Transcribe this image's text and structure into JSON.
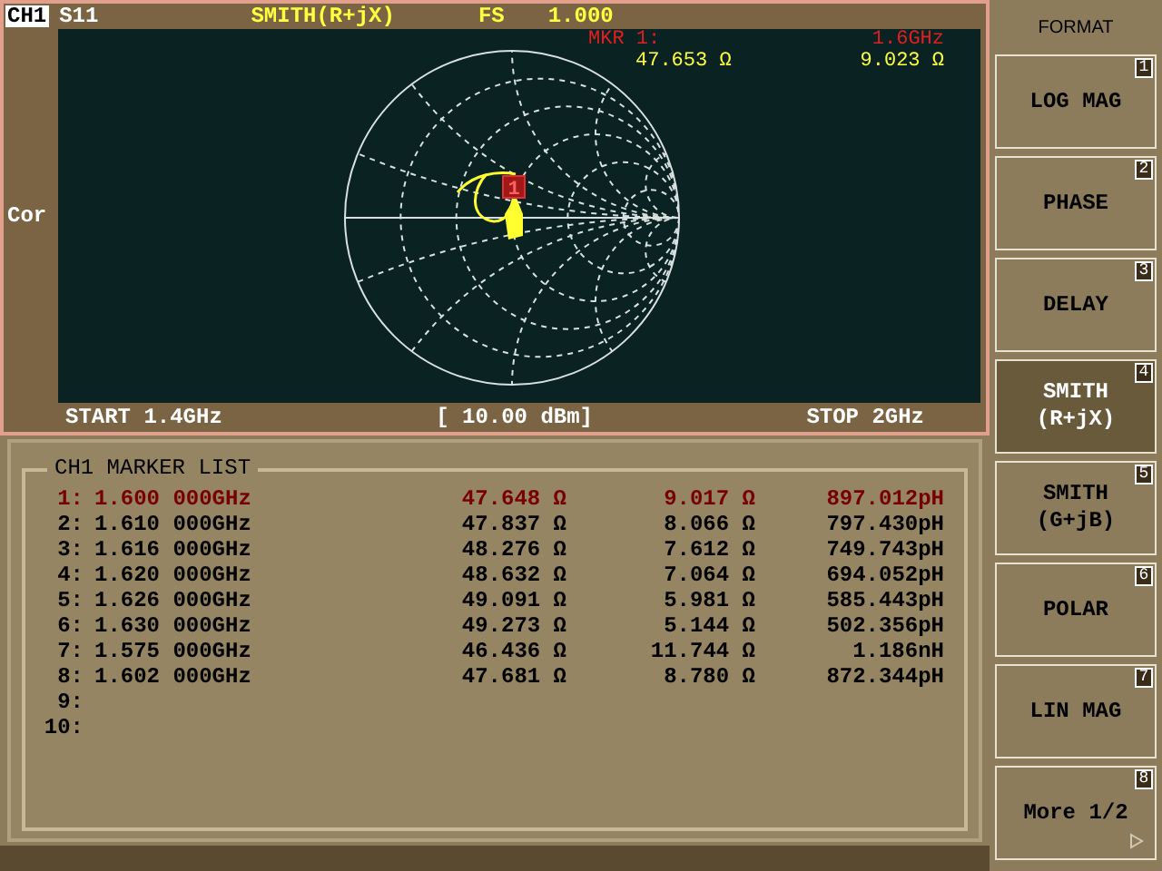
{
  "header": {
    "channel": "CH1",
    "parameter": "S11",
    "format": "SMITH(R+jX)",
    "scale_label": "FS",
    "scale_value": "1.000"
  },
  "side_label": "Cor",
  "marker_readout": {
    "label": "MKR  1:",
    "frequency": "1.6GHz",
    "resistance": "47.653 Ω",
    "reactance": "9.023 Ω"
  },
  "trace_marker": {
    "label": "1"
  },
  "footer": {
    "start": "START 1.4GHz",
    "power": "[ 10.00 dBm]",
    "stop": "STOP 2GHz"
  },
  "marker_list": {
    "title": "CH1 MARKER LIST",
    "rows": [
      {
        "number": "1:",
        "frequency": "1.600 000GHz",
        "resistance": "47.648 Ω",
        "reactance": "9.017 Ω",
        "equivalent": "897.012pH",
        "active": true
      },
      {
        "number": "2:",
        "frequency": "1.610 000GHz",
        "resistance": "47.837 Ω",
        "reactance": "8.066 Ω",
        "equivalent": "797.430pH",
        "active": false
      },
      {
        "number": "3:",
        "frequency": "1.616 000GHz",
        "resistance": "48.276 Ω",
        "reactance": "7.612 Ω",
        "equivalent": "749.743pH",
        "active": false
      },
      {
        "number": "4:",
        "frequency": "1.620 000GHz",
        "resistance": "48.632 Ω",
        "reactance": "7.064 Ω",
        "equivalent": "694.052pH",
        "active": false
      },
      {
        "number": "5:",
        "frequency": "1.626 000GHz",
        "resistance": "49.091 Ω",
        "reactance": "5.981 Ω",
        "equivalent": "585.443pH",
        "active": false
      },
      {
        "number": "6:",
        "frequency": "1.630 000GHz",
        "resistance": "49.273 Ω",
        "reactance": "5.144 Ω",
        "equivalent": "502.356pH",
        "active": false
      },
      {
        "number": "7:",
        "frequency": "1.575 000GHz",
        "resistance": "46.436 Ω",
        "reactance": "11.744 Ω",
        "equivalent": "1.186nH",
        "active": false
      },
      {
        "number": "8:",
        "frequency": "1.602 000GHz",
        "resistance": "47.681 Ω",
        "reactance": "8.780 Ω",
        "equivalent": "872.344pH",
        "active": false
      },
      {
        "number": "9:",
        "active": false
      },
      {
        "number": "10:",
        "active": false
      }
    ]
  },
  "softkeys": {
    "title": "FORMAT",
    "buttons": [
      {
        "lines": [
          "LOG MAG"
        ],
        "key": "1",
        "selected": false
      },
      {
        "lines": [
          "PHASE"
        ],
        "key": "2",
        "selected": false
      },
      {
        "lines": [
          "DELAY"
        ],
        "key": "3",
        "selected": false
      },
      {
        "lines": [
          "SMITH",
          "(R+jX)"
        ],
        "key": "4",
        "selected": true
      },
      {
        "lines": [
          "SMITH",
          "(G+jB)"
        ],
        "key": "5",
        "selected": false
      },
      {
        "lines": [
          "POLAR"
        ],
        "key": "6",
        "selected": false
      },
      {
        "lines": [
          "LIN MAG"
        ],
        "key": "7",
        "selected": false
      },
      {
        "lines": [
          "More 1/2"
        ],
        "key": "8",
        "selected": false,
        "arrow": true
      }
    ]
  }
}
